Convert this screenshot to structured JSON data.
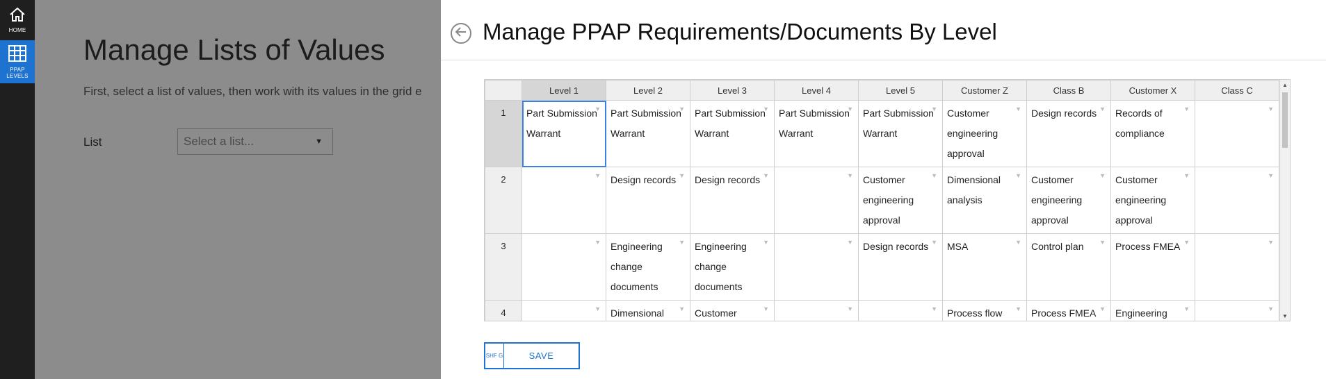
{
  "nav": {
    "items": [
      {
        "label": "HOME",
        "icon": "home-icon"
      },
      {
        "label": "PPAP\nLEVELS",
        "icon": "grid-icon",
        "active": true
      }
    ]
  },
  "background_page": {
    "title": "Manage Lists of Values",
    "subtitle": "First, select a list of values, then work with its values in the grid e",
    "list_label": "List",
    "list_placeholder": "Select a list..."
  },
  "panel": {
    "title": "Manage PPAP Requirements/Documents By Level",
    "columns": [
      "Level 1",
      "Level 2",
      "Level 3",
      "Level 4",
      "Level 5",
      "Customer Z",
      "Class B",
      "Customer X",
      "Class C"
    ],
    "rows": [
      {
        "num": "1",
        "cells": [
          "Part Submission Warrant",
          "Part Submission Warrant",
          "Part Submission Warrant",
          "Part Submission Warrant",
          "Part Submission Warrant",
          "Customer engineering approval",
          "Design records",
          "Records of compliance",
          ""
        ]
      },
      {
        "num": "2",
        "cells": [
          "",
          "Design records",
          "Design records",
          "",
          "Customer engineering approval",
          "Dimensional analysis",
          "Customer engineering approval",
          "Customer engineering approval",
          ""
        ]
      },
      {
        "num": "3",
        "cells": [
          "",
          "Engineering change documents",
          "Engineering change documents",
          "",
          "Design records",
          "MSA",
          "Control plan",
          "Process FMEA",
          ""
        ]
      },
      {
        "num": "4",
        "cells": [
          "",
          "Dimensional analysis",
          "Customer engineering",
          "",
          "",
          "Process flow diagrams",
          "Process FMEA",
          "Engineering change",
          ""
        ]
      }
    ],
    "save": {
      "shortcut": "SHF G",
      "label": "SAVE"
    }
  },
  "colors": {
    "accent": "#1e73d0",
    "nav_bg": "#1f1f1f",
    "header_selected": "#d6d6d6"
  }
}
